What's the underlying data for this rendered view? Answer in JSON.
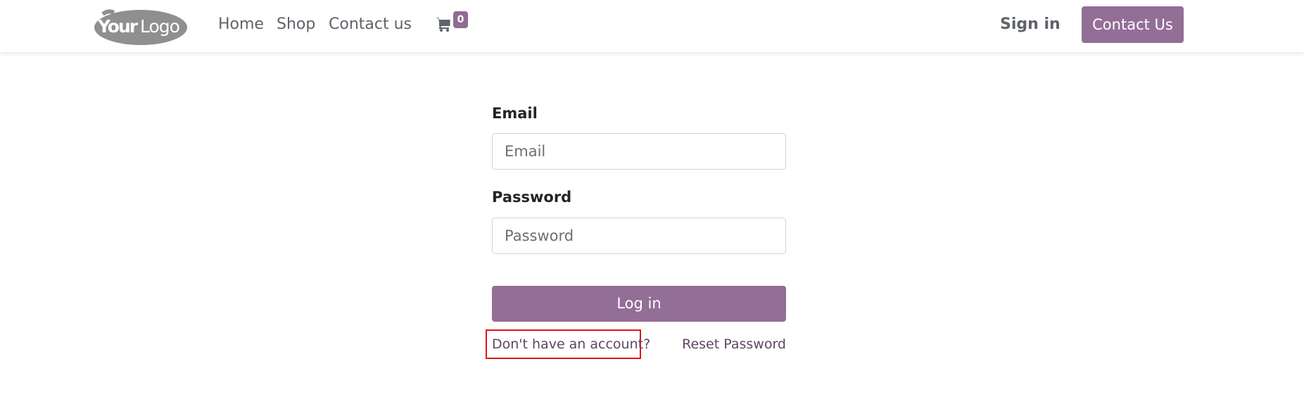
{
  "header": {
    "logo_text": "YourLogo",
    "nav": [
      {
        "label": "Home"
      },
      {
        "label": "Shop"
      },
      {
        "label": "Contact us"
      }
    ],
    "cart": {
      "icon": "shopping-cart-icon",
      "count": "0"
    },
    "sign_in_label": "Sign in",
    "contact_button_label": "Contact Us"
  },
  "login_form": {
    "email_label": "Email",
    "email_placeholder": "Email",
    "email_value": "",
    "password_label": "Password",
    "password_placeholder": "Password",
    "password_value": "",
    "login_button_label": "Log in",
    "signup_link_label": "Don't have an account?",
    "reset_link_label": "Reset Password"
  },
  "colors": {
    "brand": "#936e97",
    "link": "#5e4661",
    "highlight_border": "#e0151b"
  }
}
